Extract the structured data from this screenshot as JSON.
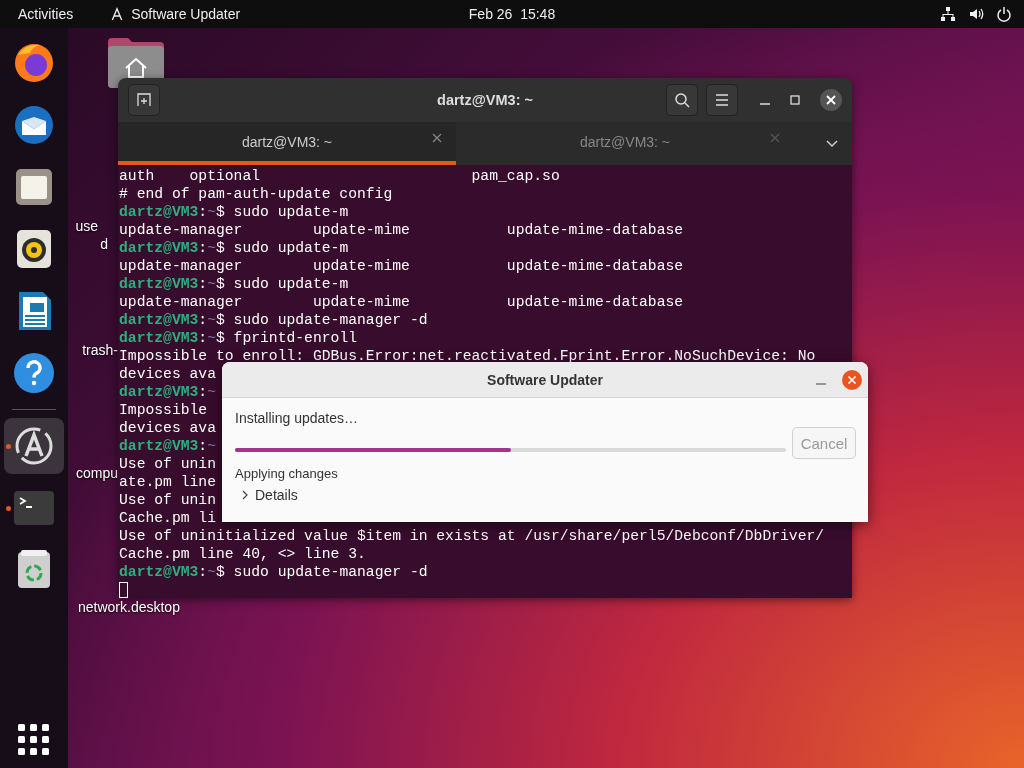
{
  "top_bar": {
    "activities": "Activities",
    "app_name": "Software Updater",
    "clock": "Feb 26  15:48"
  },
  "dock": [
    {
      "running": false,
      "focused": false
    },
    {
      "running": false,
      "focused": false
    },
    {
      "running": false,
      "focused": false
    },
    {
      "running": false,
      "focused": false
    },
    {
      "running": false,
      "focused": false
    },
    {
      "running": false,
      "focused": false
    },
    {
      "running": true,
      "focused": true
    },
    {
      "running": true,
      "focused": false
    },
    {
      "running": false,
      "focused": false
    }
  ],
  "desktop_labels": [
    "use",
    "d",
    "trash-",
    "compu",
    "network.desktop"
  ],
  "terminal": {
    "title": "dartz@VM3: ~",
    "tabs": [
      {
        "label": "dartz@VM3: ~",
        "selected": true
      },
      {
        "label": "dartz@VM3: ~",
        "selected": false
      }
    ],
    "lines": [
      {
        "kind": "output",
        "text": "auth    optional                        pam_cap.so"
      },
      {
        "kind": "output",
        "text": "# end of pam-auth-update config"
      },
      {
        "kind": "prompt",
        "user": "dartz@VM3",
        "separator": ":",
        "path": "~",
        "command": "$ sudo update-m"
      },
      {
        "kind": "output",
        "text": "update-manager        update-mime           update-mime-database"
      },
      {
        "kind": "prompt",
        "user": "dartz@VM3",
        "separator": ":",
        "path": "~",
        "command": "$ sudo update-m"
      },
      {
        "kind": "output",
        "text": "update-manager        update-mime           update-mime-database"
      },
      {
        "kind": "prompt",
        "user": "dartz@VM3",
        "separator": ":",
        "path": "~",
        "command": "$ sudo update-m"
      },
      {
        "kind": "output",
        "text": "update-manager        update-mime           update-mime-database"
      },
      {
        "kind": "prompt",
        "user": "dartz@VM3",
        "separator": ":",
        "path": "~",
        "command": "$ sudo update-manager -d"
      },
      {
        "kind": "prompt",
        "user": "dartz@VM3",
        "separator": ":",
        "path": "~",
        "command": "$ fprintd-enroll"
      },
      {
        "kind": "output",
        "text": "Impossible to enroll: GDBus.Error:net.reactivated.Fprint.Error.NoSuchDevice: No"
      },
      {
        "kind": "output",
        "text": "devices ava"
      },
      {
        "kind": "prompt",
        "user": "dartz@VM3",
        "separator": ":",
        "path": "~"
      },
      {
        "kind": "output",
        "text": "Impossible"
      },
      {
        "kind": "output",
        "text": "devices ava"
      },
      {
        "kind": "prompt",
        "user": "dartz@VM3",
        "separator": ":",
        "path": "~"
      },
      {
        "kind": "output",
        "text": "Use of unin"
      },
      {
        "kind": "output",
        "text": "ate.pm line"
      },
      {
        "kind": "output",
        "text": "Use of unin"
      },
      {
        "kind": "output",
        "text": "Cache.pm li"
      },
      {
        "kind": "output",
        "text": "Use of uninitialized value $item in exists at /usr/share/perl5/Debconf/DbDriver/"
      },
      {
        "kind": "output",
        "text": "Cache.pm line 40, <> line 3."
      },
      {
        "kind": "prompt",
        "user": "dartz@VM3",
        "separator": ":",
        "path": "~",
        "command": "$ sudo update-manager -d"
      },
      {
        "kind": "cursor"
      }
    ]
  },
  "dialog": {
    "title": "Software Updater",
    "heading": "Installing updates…",
    "progress": {
      "level": 0.5
    },
    "cancel": {
      "label": "Cancel",
      "disabled": true
    },
    "status": "Applying changes",
    "details": {
      "label": "Details",
      "expanded": false
    }
  }
}
